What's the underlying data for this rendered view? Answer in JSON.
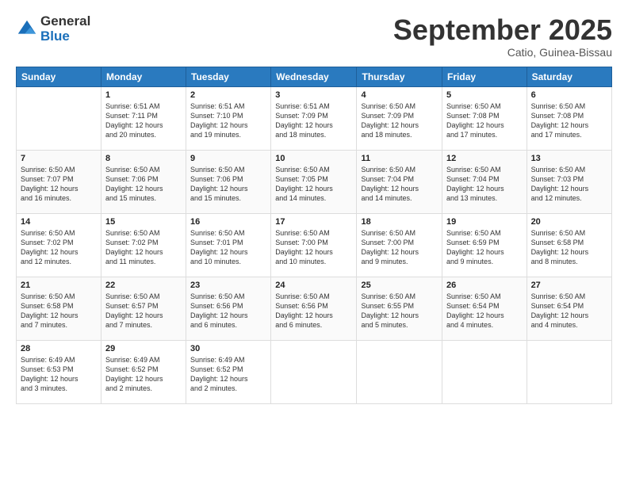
{
  "logo": {
    "general": "General",
    "blue": "Blue"
  },
  "title": "September 2025",
  "subtitle": "Catio, Guinea-Bissau",
  "days": [
    "Sunday",
    "Monday",
    "Tuesday",
    "Wednesday",
    "Thursday",
    "Friday",
    "Saturday"
  ],
  "weeks": [
    [
      {
        "num": "",
        "info": ""
      },
      {
        "num": "1",
        "info": "Sunrise: 6:51 AM\nSunset: 7:11 PM\nDaylight: 12 hours\nand 20 minutes."
      },
      {
        "num": "2",
        "info": "Sunrise: 6:51 AM\nSunset: 7:10 PM\nDaylight: 12 hours\nand 19 minutes."
      },
      {
        "num": "3",
        "info": "Sunrise: 6:51 AM\nSunset: 7:09 PM\nDaylight: 12 hours\nand 18 minutes."
      },
      {
        "num": "4",
        "info": "Sunrise: 6:50 AM\nSunset: 7:09 PM\nDaylight: 12 hours\nand 18 minutes."
      },
      {
        "num": "5",
        "info": "Sunrise: 6:50 AM\nSunset: 7:08 PM\nDaylight: 12 hours\nand 17 minutes."
      },
      {
        "num": "6",
        "info": "Sunrise: 6:50 AM\nSunset: 7:08 PM\nDaylight: 12 hours\nand 17 minutes."
      }
    ],
    [
      {
        "num": "7",
        "info": "Sunrise: 6:50 AM\nSunset: 7:07 PM\nDaylight: 12 hours\nand 16 minutes."
      },
      {
        "num": "8",
        "info": "Sunrise: 6:50 AM\nSunset: 7:06 PM\nDaylight: 12 hours\nand 15 minutes."
      },
      {
        "num": "9",
        "info": "Sunrise: 6:50 AM\nSunset: 7:06 PM\nDaylight: 12 hours\nand 15 minutes."
      },
      {
        "num": "10",
        "info": "Sunrise: 6:50 AM\nSunset: 7:05 PM\nDaylight: 12 hours\nand 14 minutes."
      },
      {
        "num": "11",
        "info": "Sunrise: 6:50 AM\nSunset: 7:04 PM\nDaylight: 12 hours\nand 14 minutes."
      },
      {
        "num": "12",
        "info": "Sunrise: 6:50 AM\nSunset: 7:04 PM\nDaylight: 12 hours\nand 13 minutes."
      },
      {
        "num": "13",
        "info": "Sunrise: 6:50 AM\nSunset: 7:03 PM\nDaylight: 12 hours\nand 12 minutes."
      }
    ],
    [
      {
        "num": "14",
        "info": "Sunrise: 6:50 AM\nSunset: 7:02 PM\nDaylight: 12 hours\nand 12 minutes."
      },
      {
        "num": "15",
        "info": "Sunrise: 6:50 AM\nSunset: 7:02 PM\nDaylight: 12 hours\nand 11 minutes."
      },
      {
        "num": "16",
        "info": "Sunrise: 6:50 AM\nSunset: 7:01 PM\nDaylight: 12 hours\nand 10 minutes."
      },
      {
        "num": "17",
        "info": "Sunrise: 6:50 AM\nSunset: 7:00 PM\nDaylight: 12 hours\nand 10 minutes."
      },
      {
        "num": "18",
        "info": "Sunrise: 6:50 AM\nSunset: 7:00 PM\nDaylight: 12 hours\nand 9 minutes."
      },
      {
        "num": "19",
        "info": "Sunrise: 6:50 AM\nSunset: 6:59 PM\nDaylight: 12 hours\nand 9 minutes."
      },
      {
        "num": "20",
        "info": "Sunrise: 6:50 AM\nSunset: 6:58 PM\nDaylight: 12 hours\nand 8 minutes."
      }
    ],
    [
      {
        "num": "21",
        "info": "Sunrise: 6:50 AM\nSunset: 6:58 PM\nDaylight: 12 hours\nand 7 minutes."
      },
      {
        "num": "22",
        "info": "Sunrise: 6:50 AM\nSunset: 6:57 PM\nDaylight: 12 hours\nand 7 minutes."
      },
      {
        "num": "23",
        "info": "Sunrise: 6:50 AM\nSunset: 6:56 PM\nDaylight: 12 hours\nand 6 minutes."
      },
      {
        "num": "24",
        "info": "Sunrise: 6:50 AM\nSunset: 6:56 PM\nDaylight: 12 hours\nand 6 minutes."
      },
      {
        "num": "25",
        "info": "Sunrise: 6:50 AM\nSunset: 6:55 PM\nDaylight: 12 hours\nand 5 minutes."
      },
      {
        "num": "26",
        "info": "Sunrise: 6:50 AM\nSunset: 6:54 PM\nDaylight: 12 hours\nand 4 minutes."
      },
      {
        "num": "27",
        "info": "Sunrise: 6:50 AM\nSunset: 6:54 PM\nDaylight: 12 hours\nand 4 minutes."
      }
    ],
    [
      {
        "num": "28",
        "info": "Sunrise: 6:49 AM\nSunset: 6:53 PM\nDaylight: 12 hours\nand 3 minutes."
      },
      {
        "num": "29",
        "info": "Sunrise: 6:49 AM\nSunset: 6:52 PM\nDaylight: 12 hours\nand 2 minutes."
      },
      {
        "num": "30",
        "info": "Sunrise: 6:49 AM\nSunset: 6:52 PM\nDaylight: 12 hours\nand 2 minutes."
      },
      {
        "num": "",
        "info": ""
      },
      {
        "num": "",
        "info": ""
      },
      {
        "num": "",
        "info": ""
      },
      {
        "num": "",
        "info": ""
      }
    ]
  ]
}
